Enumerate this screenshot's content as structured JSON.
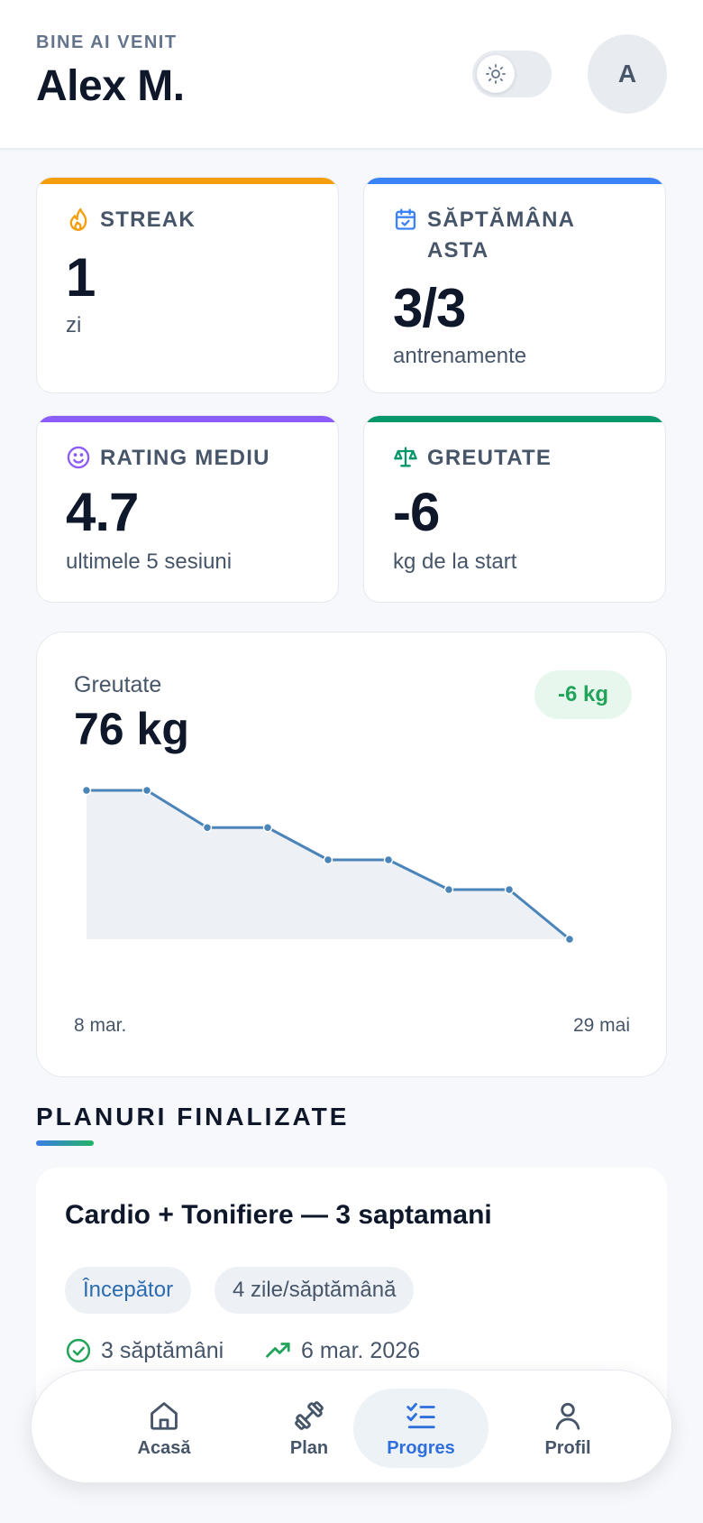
{
  "header": {
    "welcome": "BINE AI VENIT",
    "user_name": "Alex M.",
    "avatar_initial": "A",
    "theme_icon": "sun-icon"
  },
  "stats": [
    {
      "label": "STREAK",
      "value": "1",
      "sub": "zi",
      "icon": "flame-icon",
      "accent": "#f59e0b"
    },
    {
      "label_line1": "SĂPTĂMÂNA",
      "label_line2": "ASTA",
      "value": "3/3",
      "sub": "antrenamente",
      "icon": "calendar-check-icon",
      "accent": "#3b82f6"
    },
    {
      "label": "RATING MEDIU",
      "value": "4.7",
      "sub": "ultimele 5 sesiuni",
      "icon": "smile-icon",
      "accent": "#8b5cf6"
    },
    {
      "label": "GREUTATE",
      "value": "-6",
      "sub": "kg de la start",
      "icon": "scale-icon",
      "accent": "#059669"
    }
  ],
  "weight_chart": {
    "label": "Greutate",
    "current": "76 kg",
    "delta": "-6 kg",
    "x_start_label": "8 mar.",
    "x_end_label": "29 mai",
    "line_color": "#4a84b8",
    "fill_color": "#edf1f6"
  },
  "chart_data": {
    "type": "area",
    "title": "Greutate",
    "xlabel": "",
    "ylabel": "",
    "x": [
      "8 mar.",
      "",
      "",
      "",
      "",
      "",
      "",
      "",
      "29 mai"
    ],
    "series": [
      {
        "values": [
          82,
          82,
          80.5,
          80.5,
          79.2,
          79.2,
          78,
          78,
          76
        ]
      }
    ],
    "ylim": [
      76,
      82
    ],
    "grid": false
  },
  "section": {
    "title": "PLANURI FINALIZATE"
  },
  "plan": {
    "title": "Cardio + Tonifiere — 3 saptamani",
    "level": "Începător",
    "frequency": "4 zile/săptămână",
    "duration": "3 săptămâni",
    "date": "6 mar. 2026"
  },
  "nav": {
    "items": [
      {
        "label": "Acasă",
        "icon": "home-icon",
        "active": false
      },
      {
        "label": "Plan",
        "icon": "dumbbell-icon",
        "active": false
      },
      {
        "label": "Progres",
        "icon": "checklist-icon",
        "active": true
      },
      {
        "label": "Profil",
        "icon": "user-icon",
        "active": false
      }
    ]
  }
}
